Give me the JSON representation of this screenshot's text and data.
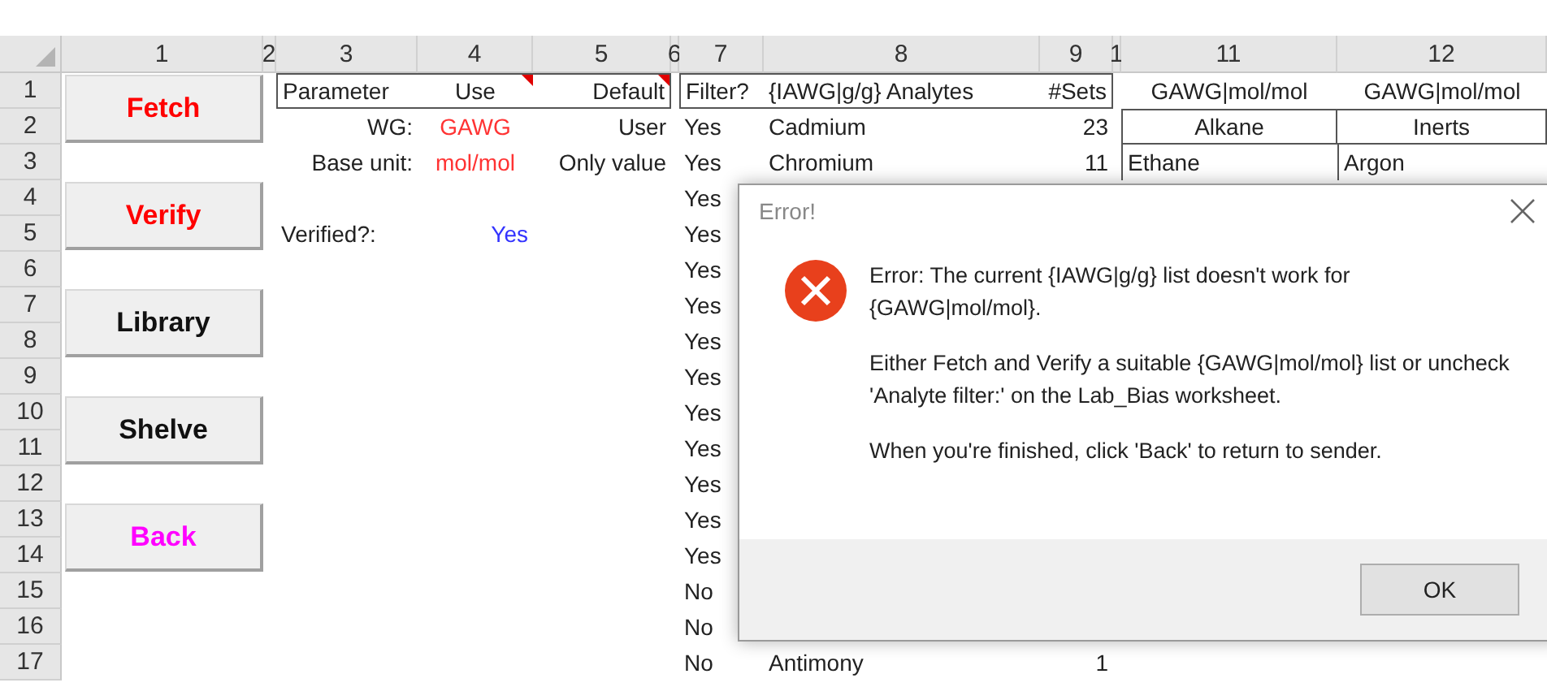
{
  "column_headers": [
    "1",
    "2",
    "3",
    "4",
    "5",
    "6",
    "7",
    "8",
    "9",
    "1",
    "11",
    "12"
  ],
  "row_headers": [
    "1",
    "2",
    "3",
    "4",
    "5",
    "6",
    "7",
    "8",
    "9",
    "10",
    "11",
    "12",
    "13",
    "14",
    "15",
    "16",
    "17"
  ],
  "action_buttons": [
    {
      "label": "Fetch",
      "color": "#ff0000"
    },
    {
      "label": "Verify",
      "color": "#ff0000"
    },
    {
      "label": "Library",
      "color": "#111111"
    },
    {
      "label": "Shelve",
      "color": "#111111"
    },
    {
      "label": "Back",
      "color": "#ff00ff"
    }
  ],
  "parameters": {
    "columns": [
      {
        "label": "Parameter",
        "comment": false
      },
      {
        "label": "Use",
        "comment": true
      },
      {
        "label": "Default",
        "comment": true
      }
    ],
    "rows": [
      {
        "label": "WG:",
        "value": "GAWG",
        "color": "#ff3333",
        "default": "User"
      },
      {
        "label": "Base unit:",
        "value": "mol/mol",
        "color": "#ff3333",
        "default": "Only value"
      },
      {
        "label": "Verified?:",
        "value": "Yes",
        "color": "#3333ff"
      }
    ]
  },
  "analytes": {
    "columns": [
      "Filter?",
      "{IAWG|g/g} Analytes",
      "#Sets"
    ],
    "rows": [
      {
        "filter": "Yes",
        "name": "Cadmium",
        "sets": "23"
      },
      {
        "filter": "Yes",
        "name": "Chromium",
        "sets": "11"
      },
      {
        "filter": "Yes"
      },
      {
        "filter": "Yes"
      },
      {
        "filter": "Yes"
      },
      {
        "filter": "Yes"
      },
      {
        "filter": "Yes"
      },
      {
        "filter": "Yes"
      },
      {
        "filter": "Yes"
      },
      {
        "filter": "Yes"
      },
      {
        "filter": "Yes"
      },
      {
        "filter": "Yes"
      },
      {
        "filter": "Yes"
      },
      {
        "filter": "No"
      },
      {
        "filter": "No"
      },
      {
        "filter": "No",
        "name": "Antimony",
        "sets": "1"
      }
    ]
  },
  "gawg": {
    "columns": [
      "GAWG|mol/mol",
      "GAWG|mol/mol"
    ],
    "groups": [
      "Alkane",
      "Inerts"
    ],
    "first_row": [
      "Ethane",
      "Argon"
    ]
  },
  "dialog": {
    "title": "Error!",
    "messages": [
      "Error: The current {IAWG|g/g} list doesn't work for {GAWG|mol/mol}.",
      "Either Fetch and Verify a suitable {GAWG|mol/mol} list or uncheck 'Analyte filter:' on the Lab_Bias worksheet.",
      "When you're finished, click 'Back' to return to sender."
    ],
    "button": "OK"
  }
}
